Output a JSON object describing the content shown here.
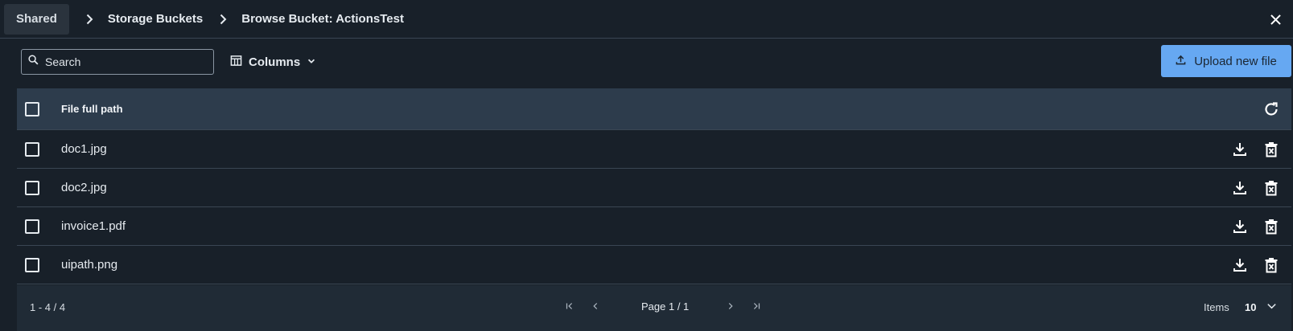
{
  "breadcrumb": {
    "items": [
      {
        "label": "Shared"
      },
      {
        "label": "Storage Buckets"
      },
      {
        "label": "Browse Bucket: ActionsTest"
      }
    ]
  },
  "toolbar": {
    "search_placeholder": "Search",
    "columns_label": "Columns",
    "upload_label": "Upload new file"
  },
  "table": {
    "header": {
      "file_full_path": "File full path"
    },
    "rows": [
      {
        "name": "doc1.jpg"
      },
      {
        "name": "doc2.jpg"
      },
      {
        "name": "invoice1.pdf"
      },
      {
        "name": "uipath.png"
      }
    ]
  },
  "footer": {
    "range": "1 - 4 / 4",
    "page_label": "Page 1 / 1",
    "items_label": "Items",
    "items_value": "10"
  },
  "colors": {
    "background": "#182029",
    "header_row": "#2d3c4c",
    "accent": "#66a8f2"
  },
  "icons": [
    "chevron-right-icon",
    "close-icon",
    "search-icon",
    "columns-icon",
    "chevron-down-icon",
    "upload-icon",
    "refresh-icon",
    "download-icon",
    "delete-icon",
    "first-page-icon",
    "prev-page-icon",
    "next-page-icon",
    "last-page-icon"
  ]
}
